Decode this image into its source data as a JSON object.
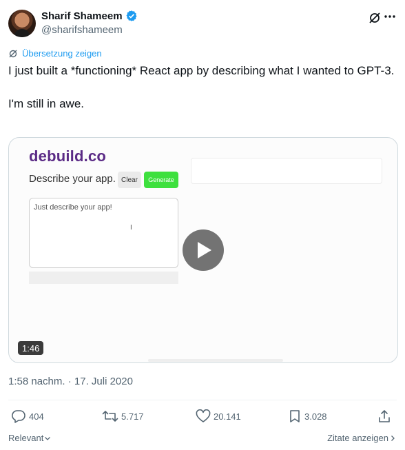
{
  "author": {
    "name": "Sharif Shameem",
    "handle": "@sharifshameem",
    "verified": true,
    "avatar_icon": "avatar-photo",
    "verified_icon": "verified-badge-icon"
  },
  "translate": {
    "label": "Übersetzung zeigen",
    "icon": "translate-icon"
  },
  "tweet": {
    "text": "I just built a *functioning* React app by describing what I wanted to GPT-3.\n\nI'm still in awe."
  },
  "media": {
    "brand": "debuild.co",
    "prompt_label": "Describe your app.",
    "clear_label": "Clear",
    "generate_label": "Generate",
    "textarea_placeholder": "Just describe your app!",
    "cursor_glyph": "I",
    "duration": "1:46",
    "play_icon": "play-icon",
    "colors": {
      "brand": "#5b2b86",
      "generate": "#3ee03e"
    }
  },
  "timestamp": "1:58 nachm. · 17. Juli 2020",
  "actions": {
    "replies": "404",
    "retweets": "5.717",
    "likes": "20.141",
    "bookmarks": "3.028"
  },
  "footer": {
    "sort_label": "Relevant",
    "quotes_label": "Zitate anzeigen"
  },
  "colors": {
    "accent": "#1d9bf0",
    "text": "#0f1419",
    "muted": "#536471"
  }
}
